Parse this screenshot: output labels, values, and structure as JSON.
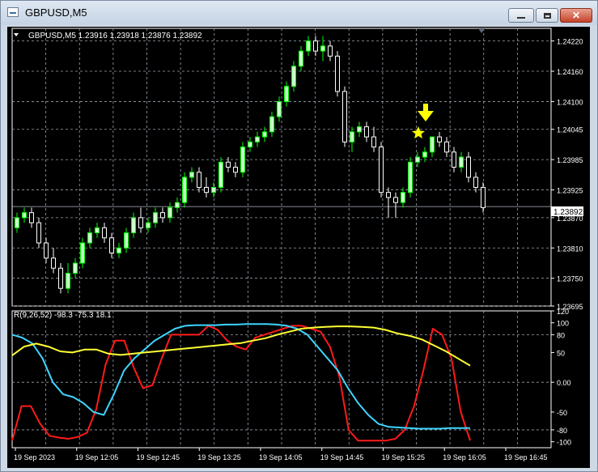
{
  "window": {
    "title": "GBPUSD,M5",
    "controls": {
      "minimize": "",
      "maximize": "",
      "close": "✕"
    }
  },
  "colors": {
    "background": "#000000",
    "grid": "#9aa4b0",
    "bull": "#00ff00",
    "bear": "#ffffff",
    "candle_fill_bull": "#c8ffc8",
    "red_line": "#ff1a1a",
    "cyan_line": "#3ed6ff",
    "yellow_line": "#ffff33",
    "arrow": "#ffff00",
    "star": "#ffff00"
  },
  "main_chart": {
    "info": "GBPUSD,M5  1.23916 1.23918 1.23876 1.23892",
    "current_price_label": "1.23892"
  },
  "indicator": {
    "info": "R(9,26,52) -98.3 -75.3 18.1"
  },
  "chart_data": [
    {
      "type": "candlestick",
      "symbol": "GBPUSD",
      "timeframe": "M5",
      "ohlc": {
        "open": 1.23916,
        "high": 1.23918,
        "low": 1.23876,
        "close": 1.23892
      },
      "price_ticks": [
        "1.24220",
        "1.24160",
        "1.24100",
        "1.24045",
        "1.23985",
        "1.23925",
        "1.23870",
        "1.23810",
        "1.23750",
        "1.23695"
      ],
      "price_range": [
        1.23695,
        1.24245
      ],
      "current_price": 1.23892,
      "time_ticks": [
        "19 Sep 2023",
        "19 Sep 12:05",
        "19 Sep 12:45",
        "19 Sep 13:25",
        "19 Sep 14:05",
        "19 Sep 14:45",
        "19 Sep 15:25",
        "19 Sep 16:05",
        "19 Sep 16:45"
      ],
      "grid": true,
      "candles": [
        [
          1.2385,
          1.2388,
          1.2384,
          1.2387
        ],
        [
          1.2387,
          1.2389,
          1.2386,
          1.2388
        ],
        [
          1.2388,
          1.2389,
          1.2385,
          1.2386
        ],
        [
          1.2386,
          1.2387,
          1.2381,
          1.2382
        ],
        [
          1.2382,
          1.2383,
          1.2378,
          1.2379
        ],
        [
          1.2379,
          1.2381,
          1.2376,
          1.2377
        ],
        [
          1.2377,
          1.2378,
          1.2372,
          1.2373
        ],
        [
          1.2373,
          1.2378,
          1.2372,
          1.2376
        ],
        [
          1.2376,
          1.2379,
          1.2375,
          1.2378
        ],
        [
          1.2378,
          1.2383,
          1.2377,
          1.2382
        ],
        [
          1.2382,
          1.2385,
          1.2381,
          1.2384
        ],
        [
          1.2384,
          1.2386,
          1.2383,
          1.2385
        ],
        [
          1.2385,
          1.2386,
          1.2382,
          1.2383
        ],
        [
          1.2383,
          1.2384,
          1.2379,
          1.238
        ],
        [
          1.238,
          1.2382,
          1.2379,
          1.2381
        ],
        [
          1.2381,
          1.2385,
          1.238,
          1.2384
        ],
        [
          1.2384,
          1.2388,
          1.2383,
          1.2387
        ],
        [
          1.2387,
          1.2389,
          1.2384,
          1.2385
        ],
        [
          1.2385,
          1.2387,
          1.2384,
          1.2386
        ],
        [
          1.2386,
          1.2389,
          1.2385,
          1.2388
        ],
        [
          1.2388,
          1.2389,
          1.2386,
          1.2387
        ],
        [
          1.2387,
          1.239,
          1.2386,
          1.2389
        ],
        [
          1.2389,
          1.2391,
          1.2388,
          1.239
        ],
        [
          1.239,
          1.2396,
          1.2389,
          1.2395
        ],
        [
          1.2395,
          1.2397,
          1.2394,
          1.2396
        ],
        [
          1.2396,
          1.2397,
          1.2392,
          1.2393
        ],
        [
          1.2393,
          1.2395,
          1.2391,
          1.2392
        ],
        [
          1.2392,
          1.2394,
          1.2391,
          1.2393
        ],
        [
          1.2393,
          1.2399,
          1.2392,
          1.2398
        ],
        [
          1.2398,
          1.2399,
          1.2396,
          1.2397
        ],
        [
          1.2397,
          1.2398,
          1.2395,
          1.2396
        ],
        [
          1.2396,
          1.2402,
          1.2395,
          1.2401
        ],
        [
          1.2401,
          1.2403,
          1.24,
          1.2402
        ],
        [
          1.2402,
          1.2404,
          1.2401,
          1.2403
        ],
        [
          1.2403,
          1.2405,
          1.2402,
          1.2404
        ],
        [
          1.2404,
          1.2408,
          1.2403,
          1.2407
        ],
        [
          1.2407,
          1.2411,
          1.2406,
          1.241
        ],
        [
          1.241,
          1.2414,
          1.2409,
          1.2413
        ],
        [
          1.2413,
          1.2418,
          1.2412,
          1.2417
        ],
        [
          1.2417,
          1.2421,
          1.2416,
          1.242
        ],
        [
          1.242,
          1.2423,
          1.2419,
          1.2422
        ],
        [
          1.2422,
          1.2423,
          1.2419,
          1.242
        ],
        [
          1.242,
          1.2423,
          1.2418,
          1.2421
        ],
        [
          1.2421,
          1.2422,
          1.2418,
          1.2419
        ],
        [
          1.2419,
          1.242,
          1.2411,
          1.2412
        ],
        [
          1.2412,
          1.2413,
          1.2401,
          1.2402
        ],
        [
          1.2402,
          1.2405,
          1.24,
          1.2404
        ],
        [
          1.2404,
          1.2406,
          1.2403,
          1.2405
        ],
        [
          1.2405,
          1.2406,
          1.2402,
          1.2403
        ],
        [
          1.2403,
          1.2405,
          1.24,
          1.2401
        ],
        [
          1.2401,
          1.2402,
          1.2391,
          1.2392
        ],
        [
          1.2392,
          1.2393,
          1.2387,
          1.2391
        ],
        [
          1.2391,
          1.2392,
          1.2387,
          1.239
        ],
        [
          1.239,
          1.2393,
          1.2389,
          1.2392
        ],
        [
          1.2392,
          1.2399,
          1.2391,
          1.2398
        ],
        [
          1.2398,
          1.24,
          1.2397,
          1.2399
        ],
        [
          1.2399,
          1.2401,
          1.2398,
          1.24
        ],
        [
          1.24,
          1.2403,
          1.2399,
          1.2403
        ],
        [
          1.2403,
          1.2404,
          1.2401,
          1.2402
        ],
        [
          1.2402,
          1.2403,
          1.2399,
          1.24
        ],
        [
          1.24,
          1.2401,
          1.2396,
          1.2397
        ],
        [
          1.2397,
          1.24,
          1.2396,
          1.2399
        ],
        [
          1.2399,
          1.24,
          1.2394,
          1.2395
        ],
        [
          1.2395,
          1.2396,
          1.2392,
          1.2393
        ],
        [
          1.2393,
          1.2394,
          1.2388,
          1.2389
        ]
      ]
    },
    {
      "type": "line",
      "title": "R(9,26,52) -98.3 -75.3 18.1",
      "ylim": [
        -110,
        120
      ],
      "y_ticks": [
        "120",
        "100",
        "80",
        "50",
        "0.00",
        "-50",
        "-80",
        "-100"
      ],
      "series": [
        {
          "color": "#ff1a1a",
          "values": [
            -98,
            -40,
            -40,
            -70,
            -90,
            -93,
            -95,
            -92,
            -85,
            -45,
            30,
            70,
            70,
            25,
            -10,
            -5,
            40,
            80,
            80,
            80,
            80,
            95,
            88,
            70,
            60,
            55,
            75,
            80,
            85,
            90,
            95,
            95,
            90,
            85,
            60,
            10,
            -80,
            -98,
            -98,
            -98,
            -98,
            -95,
            -80,
            -40,
            20,
            90,
            80,
            40,
            -50,
            -98
          ]
        },
        {
          "color": "#3ed6ff",
          "values": [
            80,
            75,
            65,
            40,
            0,
            -20,
            -25,
            -35,
            -50,
            -55,
            -20,
            20,
            40,
            55,
            70,
            80,
            90,
            95,
            96,
            96,
            96,
            97,
            97,
            98,
            98,
            98,
            97,
            95,
            90,
            80,
            60,
            40,
            20,
            -10,
            -35,
            -55,
            -70,
            -75,
            -76,
            -77,
            -78,
            -78,
            -78,
            -77,
            -77,
            -77
          ]
        },
        {
          "color": "#ffff33",
          "values": [
            45,
            60,
            65,
            60,
            52,
            50,
            55,
            55,
            48,
            46,
            48,
            50,
            52,
            54,
            56,
            58,
            60,
            62,
            64,
            66,
            70,
            74,
            80,
            85,
            90,
            92,
            93,
            94,
            94,
            93,
            92,
            88,
            82,
            78,
            72,
            62,
            52,
            40,
            28
          ]
        }
      ]
    }
  ]
}
